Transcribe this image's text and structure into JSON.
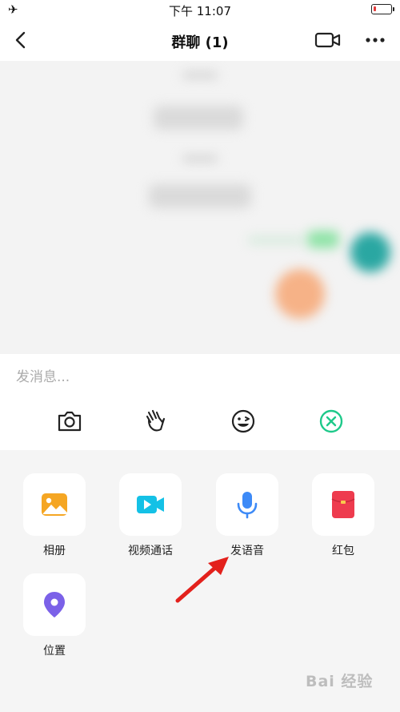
{
  "status_bar": {
    "time": "下午 11:07"
  },
  "nav": {
    "title": "群聊 (1)"
  },
  "input": {
    "placeholder": "发消息..."
  },
  "apps": [
    {
      "label": "相册",
      "icon": "photo-album-icon",
      "color": "#f5a623"
    },
    {
      "label": "视频通话",
      "icon": "video-call-icon",
      "color": "#14c1e6"
    },
    {
      "label": "发语音",
      "icon": "microphone-icon",
      "color": "#3d8af7"
    },
    {
      "label": "红包",
      "icon": "red-envelope-icon",
      "color": "#ee3b4e"
    },
    {
      "label": "位置",
      "icon": "location-pin-icon",
      "color": "#7b61e8"
    }
  ],
  "watermark": "Bai 经验",
  "colors": {
    "accent_green": "#1ec98a",
    "annotation_arrow": "#e3211c"
  }
}
